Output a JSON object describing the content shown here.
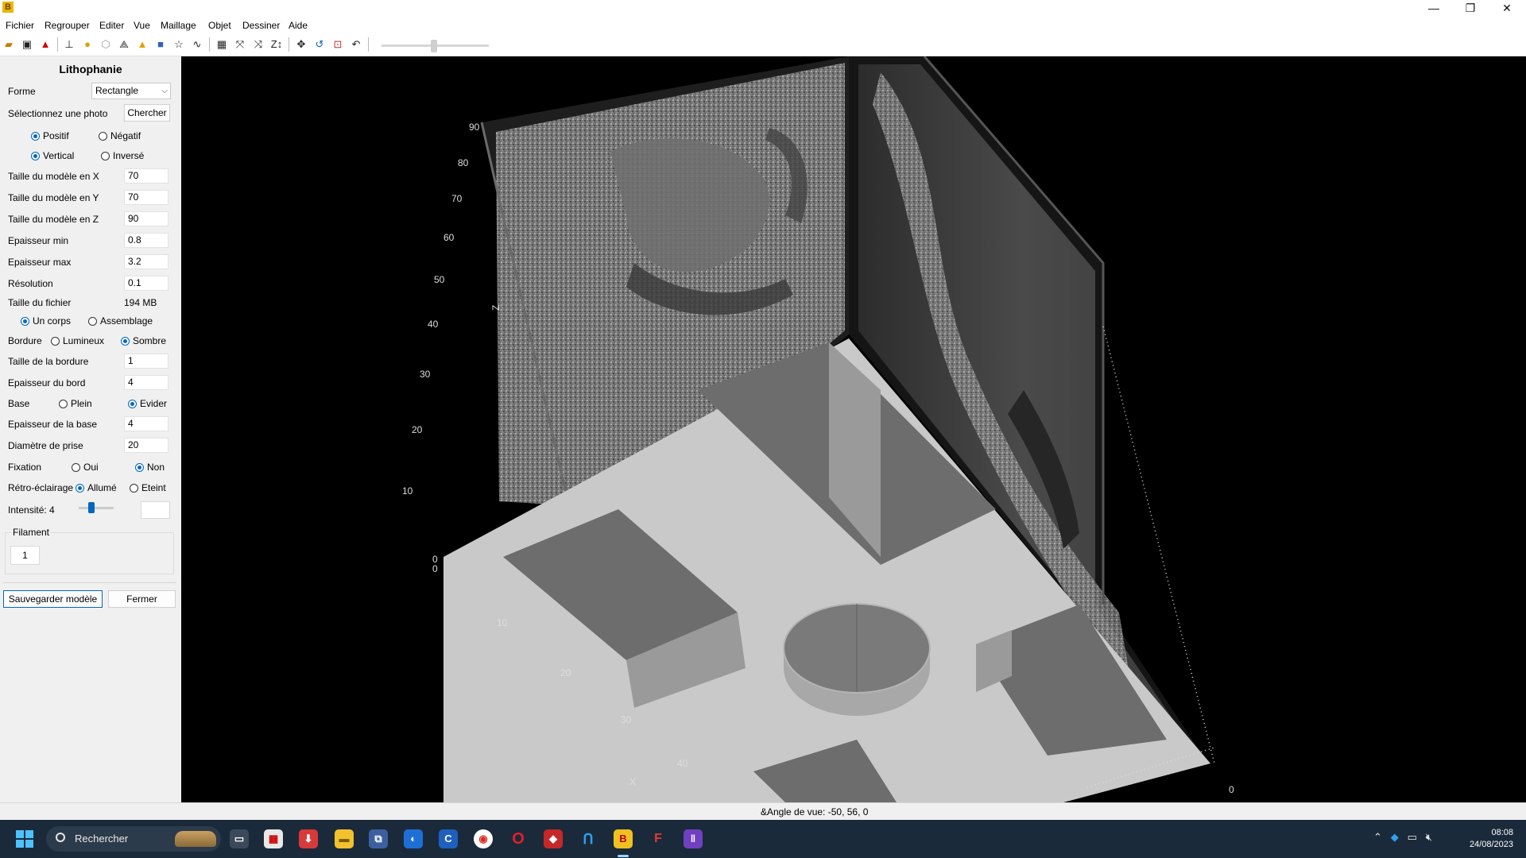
{
  "window": {
    "min_glyph": "—",
    "max_glyph": "❐",
    "close_glyph": "✕"
  },
  "menu": [
    "Fichier",
    "Regrouper",
    "Editer",
    "Vue",
    "Maillage",
    "Objet",
    "Dessiner",
    "Aide"
  ],
  "panel": {
    "title": "Lithophanie",
    "forme_label": "Forme",
    "forme_value": "Rectangle",
    "photo_label": "Sélectionnez une photo",
    "chercher": "Chercher",
    "positif": "Positif",
    "negatif": "Négatif",
    "vertical": "Vertical",
    "inverse": "Inversé",
    "fields": [
      {
        "label": "Taille du modèle en X",
        "value": "70"
      },
      {
        "label": "Taille du modèle en Y",
        "value": "70"
      },
      {
        "label": "Taille du modèle en Z",
        "value": "90"
      },
      {
        "label": "Epaisseur min",
        "value": "0.8"
      },
      {
        "label": "Epaisseur max",
        "value": "3.2"
      },
      {
        "label": "Résolution",
        "value": "0.1"
      }
    ],
    "file_size_label": "Taille du fichier",
    "file_size_value": "194 MB",
    "un_corps": "Un corps",
    "assemblage": "Assemblage",
    "bordure_label": "Bordure",
    "lumineux": "Lumineux",
    "sombre": "Sombre",
    "taille_bordure_label": "Taille de la bordure",
    "taille_bordure_value": "1",
    "epaisseur_bord_label": "Epaisseur du bord",
    "epaisseur_bord_value": "4",
    "base_label": "Base",
    "plein": "Plein",
    "evider": "Evider",
    "epaisseur_base_label": "Epaisseur de la base",
    "epaisseur_base_value": "4",
    "diametre_label": "Diamètre de prise",
    "diametre_value": "20",
    "fixation_label": "Fixation",
    "oui": "Oui",
    "non": "Non",
    "retro_label": "Rétro-éclairage",
    "allume": "Allumé",
    "eteint": "Eteint",
    "intensite_label": "Intensité: 4",
    "filament_label": "Filament",
    "filament_value": "1",
    "save_button": "Sauvegarder modèle",
    "close_button": "Fermer"
  },
  "viewport": {
    "z_label": "Z",
    "x_label": "X",
    "z_ticks": [
      "0",
      "10",
      "20",
      "30",
      "40",
      "50",
      "60",
      "70",
      "80",
      "90"
    ],
    "x_ticks": [
      "0",
      "10",
      "20",
      "30",
      "40"
    ],
    "y_ticks": [
      "0"
    ]
  },
  "status": "&Angle de vue: -50, 56, 0",
  "taskbar": {
    "search_placeholder": "Rechercher",
    "time": "08:08",
    "date": "24/08/2023"
  }
}
